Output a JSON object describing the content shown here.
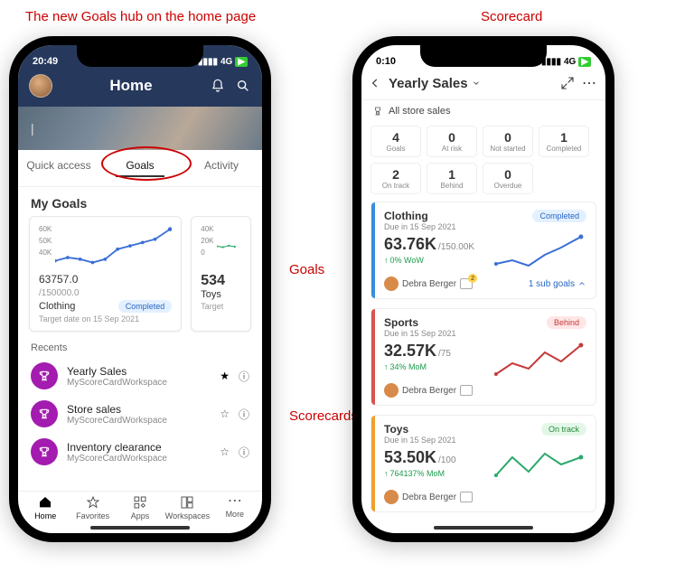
{
  "annotations": {
    "top_left": "The new Goals hub on the home page",
    "top_right": "Scorecard",
    "mid_right": "Goals",
    "low_right": "Scorecards"
  },
  "phone1": {
    "status": {
      "time": "20:49",
      "net": "4G"
    },
    "header": {
      "title": "Home"
    },
    "tabs": {
      "quick": "Quick access",
      "goals": "Goals",
      "activity": "Activity"
    },
    "section": "My Goals",
    "goal_card_1": {
      "yticks": [
        "60K",
        "50K",
        "40K"
      ],
      "value": "63757.0",
      "target": "/150000.0",
      "name": "Clothing",
      "status": "Completed",
      "date": "Target date on 15 Sep 2021"
    },
    "goal_card_2": {
      "yticks": [
        "40K",
        "20K",
        "0"
      ],
      "value": "534",
      "name": "Toys",
      "date": "Target"
    },
    "recents_title": "Recents",
    "recents": [
      {
        "name": "Yearly Sales",
        "ws": "MyScoreCardWorkspace",
        "fav": true
      },
      {
        "name": "Store sales",
        "ws": "MyScoreCardWorkspace",
        "fav": false
      },
      {
        "name": "Inventory clearance",
        "ws": "MyScoreCardWorkspace",
        "fav": false
      }
    ],
    "bottom": {
      "home": "Home",
      "fav": "Favorites",
      "apps": "Apps",
      "ws": "Workspaces",
      "more": "More"
    }
  },
  "phone2": {
    "status": {
      "time": "0:10",
      "net": "4G"
    },
    "title": "Yearly Sales",
    "crumb": "All store sales",
    "stats": [
      {
        "n": "4",
        "l": "Goals"
      },
      {
        "n": "0",
        "l": "At risk"
      },
      {
        "n": "0",
        "l": "Not started"
      },
      {
        "n": "1",
        "l": "Completed"
      },
      {
        "n": "2",
        "l": "On track"
      },
      {
        "n": "1",
        "l": "Behind"
      },
      {
        "n": "0",
        "l": "Overdue"
      }
    ],
    "goals": [
      {
        "name": "Clothing",
        "due": "Due in 15 Sep 2021",
        "value": "63.76K",
        "target": "/150.00K",
        "delta": "0% WoW",
        "status": "Completed",
        "owner": "Debra Berger",
        "sub": "1 sub goals",
        "color": "blue"
      },
      {
        "name": "Sports",
        "due": "Due in 15 Sep 2021",
        "value": "32.57K",
        "target": "/75",
        "delta": "34% MoM",
        "status": "Behind",
        "owner": "Debra Berger",
        "color": "red"
      },
      {
        "name": "Toys",
        "due": "Due in 15 Sep 2021",
        "value": "53.50K",
        "target": "/100",
        "delta": "764137% MoM",
        "status": "On track",
        "owner": "Debra Berger",
        "color": "orange"
      }
    ]
  },
  "chart_data": [
    {
      "type": "line",
      "title": "Clothing goal sparkline (phone 1)",
      "ylim": [
        40000,
        60000
      ],
      "x": [
        1,
        2,
        3,
        4,
        5,
        6,
        7,
        8,
        9,
        10
      ],
      "values": [
        42000,
        44000,
        43000,
        41000,
        43000,
        48000,
        50000,
        52000,
        54000,
        60000
      ]
    },
    {
      "type": "line",
      "title": "Toys goal sparkline (phone 1, partial)",
      "ylim": [
        0,
        40000
      ],
      "x": [
        1,
        2,
        3,
        4
      ],
      "values": [
        20000,
        19000,
        21000,
        20000
      ]
    },
    {
      "type": "line",
      "title": "Clothing sparkline (phone 2)",
      "x": [
        1,
        2,
        3,
        4,
        5,
        6
      ],
      "values": [
        40,
        42,
        38,
        45,
        50,
        64
      ]
    },
    {
      "type": "line",
      "title": "Sports sparkline (phone 2)",
      "x": [
        1,
        2,
        3,
        4,
        5,
        6
      ],
      "values": [
        20,
        30,
        25,
        38,
        30,
        45
      ]
    },
    {
      "type": "line",
      "title": "Toys sparkline (phone 2)",
      "x": [
        1,
        2,
        3,
        4,
        5,
        6
      ],
      "values": [
        30,
        50,
        35,
        55,
        45,
        54
      ]
    }
  ]
}
